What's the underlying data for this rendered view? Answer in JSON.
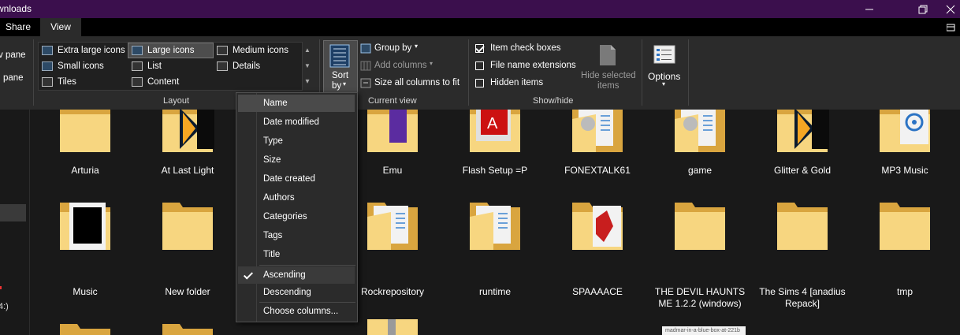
{
  "window": {
    "title": "wnloads",
    "minimize_icon": "minimize-icon",
    "restore_icon": "restore-icon",
    "close_icon": "close-icon"
  },
  "tabs": {
    "share": "Share",
    "view": "View"
  },
  "pane_labels": {
    "preview_pane": "v pane",
    "details_pane": "pane"
  },
  "layout": {
    "group_label": "Layout",
    "items": {
      "extra_large": "Extra large icons",
      "large": "Large icons",
      "medium": "Medium icons",
      "small": "Small icons",
      "list": "List",
      "details": "Details",
      "tiles": "Tiles",
      "content": "Content"
    }
  },
  "current_view": {
    "group_label": "Current view",
    "sort_by_line1": "Sort",
    "sort_by_line2": "by",
    "group_by": "Group by",
    "add_columns": "Add columns",
    "size_columns": "Size all columns to fit"
  },
  "show_hide": {
    "group_label": "Show/hide",
    "item_check_boxes": "Item check boxes",
    "item_check_boxes_checked": true,
    "file_name_extensions": "File name extensions",
    "file_name_extensions_checked": false,
    "hidden_items": "Hidden items",
    "hidden_items_checked": false,
    "hide_selected_line1": "Hide selected",
    "hide_selected_line2": "items"
  },
  "options": {
    "label": "Options"
  },
  "sort_menu": {
    "items": [
      "Name",
      "Date modified",
      "Type",
      "Size",
      "Date created",
      "Authors",
      "Categories",
      "Tags",
      "Title"
    ],
    "ascending": "Ascending",
    "descending": "Descending",
    "choose_columns": "Choose columns...",
    "highlighted": "Name",
    "order_checked": "Ascending"
  },
  "nav": {
    "fragment": "4:)"
  },
  "files": {
    "row1": [
      "Arturia",
      "At Last Light",
      "Emu",
      "Flash Setup =P",
      "FONEXTALK61",
      "game",
      "Glitter & Gold",
      "MP3 Music"
    ],
    "row2": [
      "Music",
      "New folder",
      "Rockrepository",
      "runtime",
      "SPAAAACE",
      "THE DEVIL HAUNTS ME 1.2.2 (windows)",
      "The Sims 4 [anadius Repack]",
      "tmp"
    ],
    "thumb_caption": "madmar-in-a-blue-box-at-221b"
  }
}
